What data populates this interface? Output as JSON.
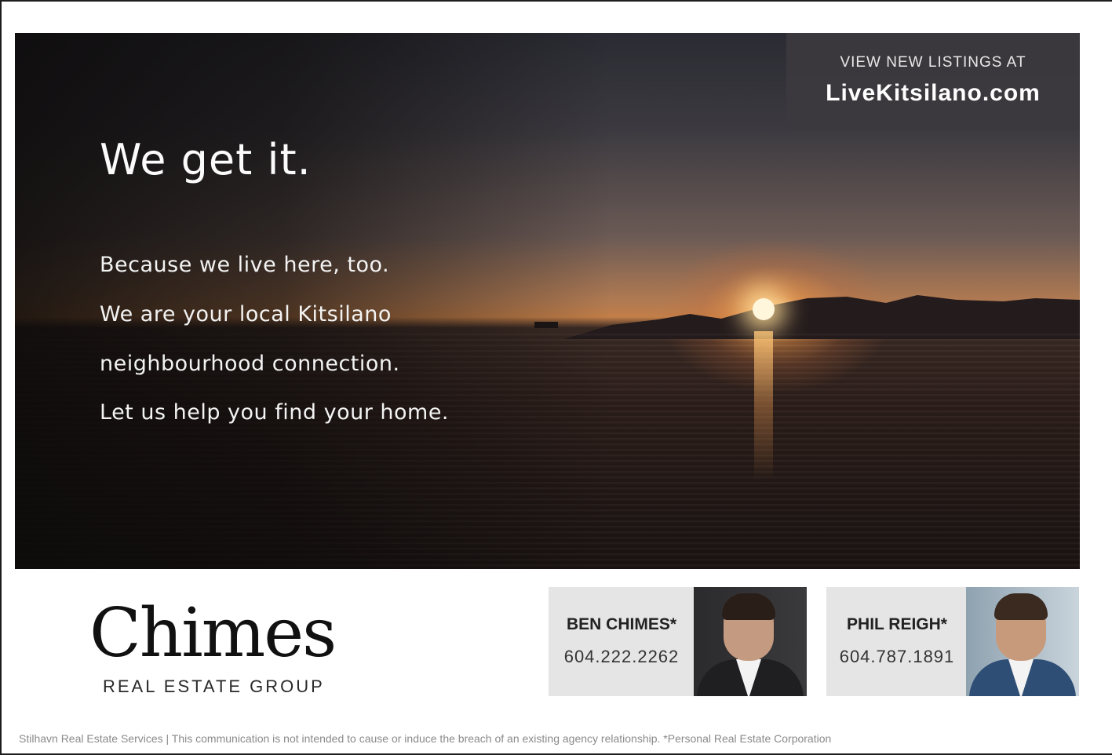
{
  "hero": {
    "headline": "We get it.",
    "lines": [
      "Because we live here, too.",
      "We are your local Kitsilano",
      "neighbourhood connection.",
      "Let us help you find your home."
    ]
  },
  "cta": {
    "kicker": "VIEW NEW LISTINGS AT",
    "url": "LiveKitsilano.com"
  },
  "brand": {
    "name": "Chimes",
    "tagline": "REAL ESTATE GROUP"
  },
  "agents": [
    {
      "name": "BEN CHIMES*",
      "phone": "604.222.2262",
      "photo_icon": "ben-chimes-portrait"
    },
    {
      "name": "PHIL REIGH*",
      "phone": "604.787.1891",
      "photo_icon": "phil-reigh-portrait"
    }
  ],
  "disclaimer": "Stilhavn Real Estate Services | This communication is not intended to cause or induce the breach of an existing agency relationship. *Personal Real Estate Corporation",
  "colors": {
    "cta_background": "#3c3a3e",
    "card_background": "#e5e5e5",
    "sunset_orange": "#c27e48"
  }
}
